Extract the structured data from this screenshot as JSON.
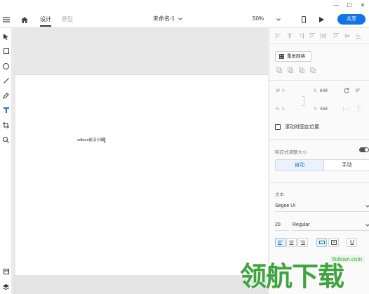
{
  "window": {
    "minimize_glyph": "—",
    "maximize_glyph": "☐",
    "close_glyph": "✕"
  },
  "toolbar": {
    "tabs": [
      {
        "label": "设计"
      },
      {
        "label": "原型"
      }
    ],
    "document_title": "未命名-1",
    "zoom": "50%",
    "share_label": "共享"
  },
  "canvas": {
    "artboard_text": "zdfans前沿小编"
  },
  "panel": {
    "repeat_grid_label": "重复网格",
    "transform": {
      "w_label": "W",
      "w_value": "0",
      "x_label": "X",
      "x_value": "648",
      "rotation_value": "0°",
      "h_label": "H",
      "h_value": "0",
      "y_label": "Y",
      "y_value": "358"
    },
    "fix_position_label": "滚动时固定位置",
    "responsive_label": "响应式调整大小",
    "resize_modes": {
      "auto": "自动",
      "manual": "手动"
    },
    "text_section_label": "文本",
    "font_family": "Segoe UI",
    "font_size": "20",
    "font_weight": "Regular"
  },
  "watermark": {
    "text": "领航下载",
    "url": "lhdown.com"
  },
  "colors": {
    "accent": "#1473e6",
    "watermark": "#3fa33f"
  }
}
